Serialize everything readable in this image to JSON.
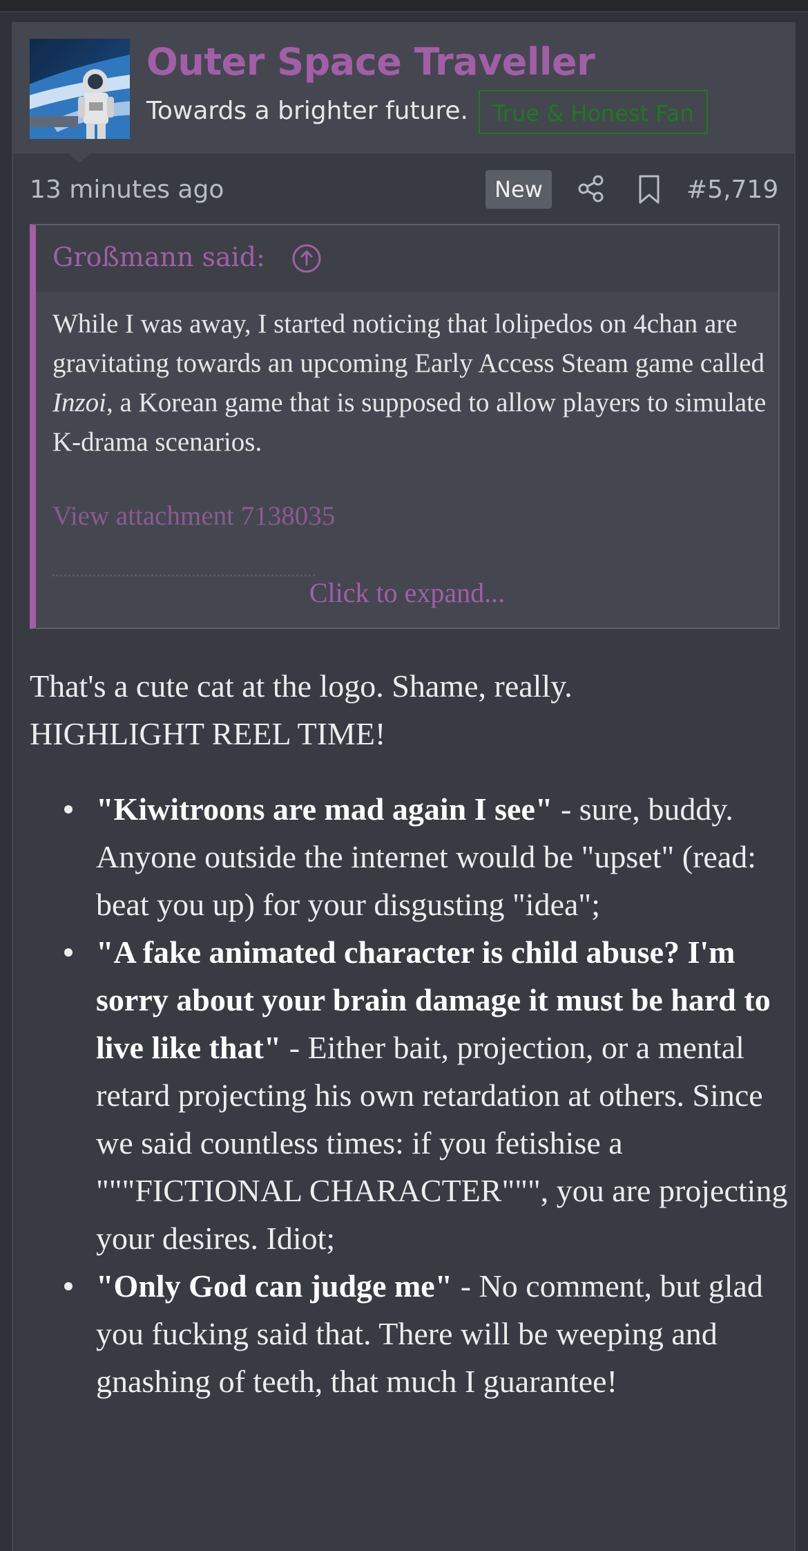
{
  "user": {
    "name": "Outer Space Traveller",
    "title": "Towards a brighter future.",
    "banner": "True & Honest Fan",
    "avatar_icon": "astronaut-avatar"
  },
  "post": {
    "time": "13 minutes ago",
    "new_badge": "New",
    "number": "#5,719"
  },
  "quote": {
    "author": "Großmann said:",
    "body_before": "While I was away, I started noticing that lolipedos on 4chan are gravitating towards an upcoming Early Access Steam game called ",
    "body_italic": "Inzoi",
    "body_after": ", a Korean game that is supposed to allow players to simulate K-drama scenarios.",
    "attachment": "View attachment 7138035",
    "expand": "Click to expand..."
  },
  "message": {
    "intro_line1": "That's a cute cat at the logo. Shame, really.",
    "intro_line2": "HIGHLIGHT REEL TIME!",
    "items": [
      {
        "bold": "\"Kiwitroons are mad again I see\"",
        "text": " - sure, buddy. Anyone outside the internet would be \"upset\" (read: beat you up) for your disgusting \"idea\";"
      },
      {
        "bold": "\"A fake animated character is child abuse? I'm sorry about your brain damage it must be hard to live like that\"",
        "text": " - Either bait, projection, or a mental retard projecting his own retardation at others. Since we said countless times: if you fetishise a \"\"\"FICTIONAL CHARACTER\"\"\", you are projecting your desires. Idiot;"
      },
      {
        "bold": "\"Only God can judge me\"",
        "text": " - No comment, but glad you fucking said that. There will be weeping and gnashing of teeth, that much I guarantee!"
      }
    ]
  },
  "colors": {
    "accent": "#a35ea8",
    "banner_green": "#1d7a1d",
    "background": "#383b42"
  }
}
